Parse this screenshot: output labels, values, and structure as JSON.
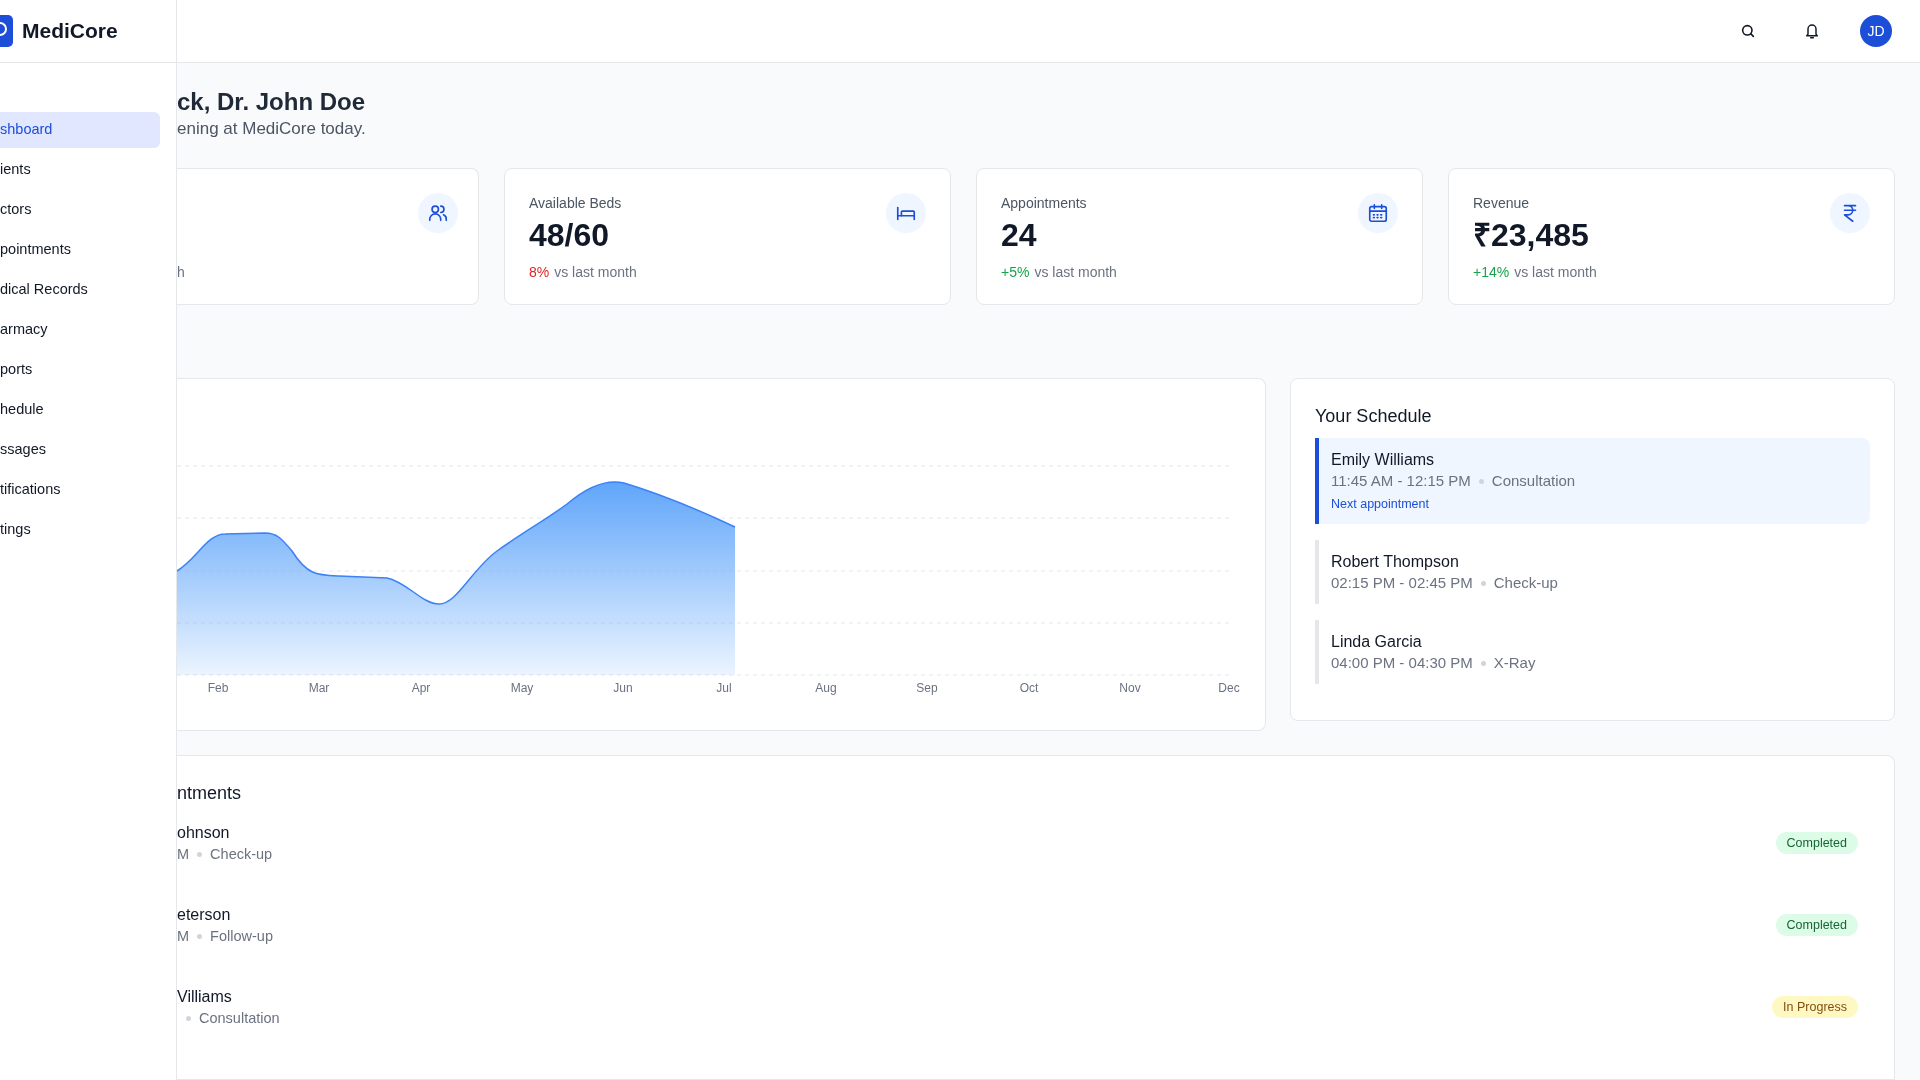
{
  "brand": "MediCore",
  "header": {
    "avatar": "JD"
  },
  "sidebar": {
    "items": [
      {
        "label": "shboard",
        "selected": true
      },
      {
        "label": "ients",
        "selected": false
      },
      {
        "label": "ctors",
        "selected": false
      },
      {
        "label": "pointments",
        "selected": false
      },
      {
        "label": "dical Records",
        "selected": false
      },
      {
        "label": "armacy",
        "selected": false
      },
      {
        "label": "ports",
        "selected": false
      },
      {
        "label": "hedule",
        "selected": false
      },
      {
        "label": "ssages",
        "selected": false
      },
      {
        "label": "tifications",
        "selected": false
      },
      {
        "label": "tings",
        "selected": false
      }
    ]
  },
  "greeting": {
    "title": "ck, Dr. John Doe",
    "subtitle": "ening at MediCore today."
  },
  "stats": [
    {
      "note": "h"
    },
    {
      "label": "Available Beds",
      "value": "48/60",
      "change": "8%",
      "note": "vs last month",
      "color": "#dc2626"
    },
    {
      "label": "Appointments",
      "value": "24",
      "change": "+5%",
      "note": "vs last month",
      "color": "#16a34a"
    },
    {
      "label": "Revenue",
      "value": "₹23,485",
      "change": "+14%",
      "note": "vs last month",
      "color": "#16a34a"
    }
  ],
  "chart": {
    "x_labels": [
      "Feb",
      "Mar",
      "Apr",
      "May",
      "Jun",
      "Jul",
      "Aug",
      "Sep",
      "Oct",
      "Nov",
      "Dec"
    ]
  },
  "schedule": {
    "title": "Your Schedule",
    "items": [
      {
        "name": "Emily Williams",
        "time": "11:45 AM - 12:15 PM",
        "type": "Consultation",
        "note": "Next appointment",
        "selected": true
      },
      {
        "name": "Robert Thompson",
        "time": "02:15 PM - 02:45 PM",
        "type": "Check-up",
        "selected": false
      },
      {
        "name": "Linda Garcia",
        "time": "04:00 PM - 04:30 PM",
        "type": "X-Ray",
        "selected": false
      }
    ]
  },
  "recent": {
    "title": "ntments",
    "rows": [
      {
        "name": "ohnson",
        "time": "M",
        "type": "Check-up",
        "status": "Completed",
        "kind": "completed"
      },
      {
        "name": "eterson",
        "time": "M",
        "type": "Follow-up",
        "status": "Completed",
        "kind": "completed"
      },
      {
        "name": "Villiams",
        "type": "Consultation",
        "status": "In Progress",
        "kind": "in_progress"
      }
    ]
  }
}
